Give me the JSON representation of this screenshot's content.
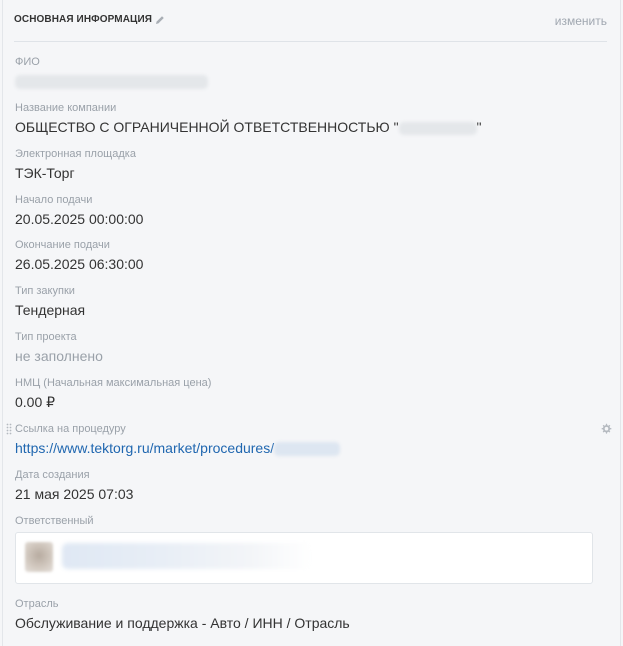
{
  "section": {
    "title": "ОСНОВНАЯ ИНФОРМАЦИЯ",
    "edit_label": "изменить"
  },
  "fields": {
    "fio": {
      "label": "ФИО",
      "value": ""
    },
    "company": {
      "label": "Название компании",
      "value_prefix": "ОБЩЕСТВО С ОГРАНИЧЕННОЙ ОТВЕТСТВЕННОСТЬЮ \"",
      "value_suffix": "\""
    },
    "platform": {
      "label": "Электронная площадка",
      "value": "ТЭК-Торг"
    },
    "start": {
      "label": "Начало подачи",
      "value": "20.05.2025 00:00:00"
    },
    "end": {
      "label": "Окончание подачи",
      "value": "26.05.2025 06:30:00"
    },
    "purchase_type": {
      "label": "Тип закупки",
      "value": "Тендерная"
    },
    "project_type": {
      "label": "Тип проекта",
      "value": "не заполнено"
    },
    "nmc": {
      "label": "НМЦ (Начальная максимальная цена)",
      "value": "0.00 ₽"
    },
    "link": {
      "label": "Ссылка на процедуру",
      "value": "https://www.tektorg.ru/market/procedures/"
    },
    "created": {
      "label": "Дата создания",
      "value": "21 мая 2025 07:03"
    },
    "responsible": {
      "label": "Ответственный"
    },
    "industry": {
      "label": "Отрасль",
      "value": "Обслуживание и поддержка - Авто / ИНН / Отрасль"
    }
  },
  "icons": {
    "edit": "pencil-icon",
    "settings": "gear-icon",
    "drag": "drag-handle-icon"
  },
  "colors": {
    "link": "#2067b0",
    "label": "#9aa1a9",
    "text": "#333333",
    "background": "#f5f6f8"
  }
}
